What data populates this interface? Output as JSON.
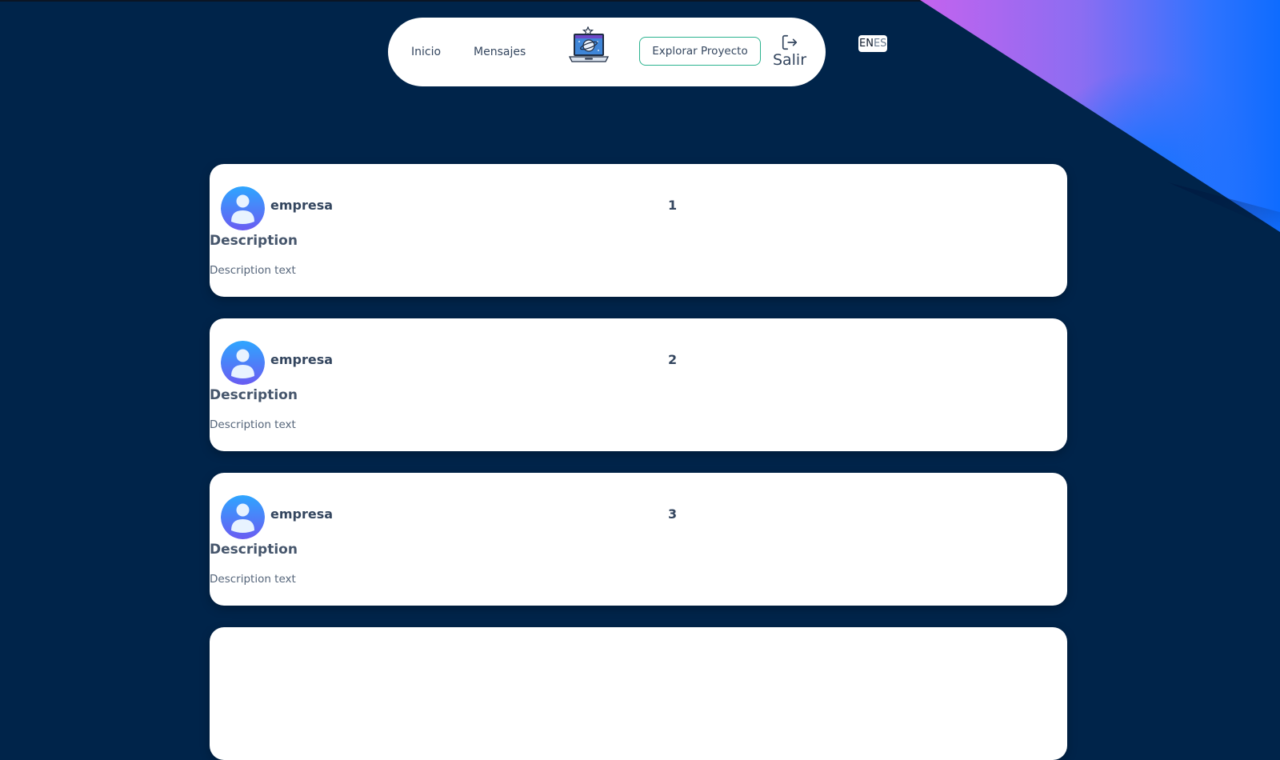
{
  "nav": {
    "inicio": "Inicio",
    "mensajes": "Mensajes",
    "explore_button": "Explorar Proyecto",
    "logout_label": "Salir"
  },
  "lang": {
    "en": "EN",
    "es": "ES"
  },
  "colors": {
    "background": "#00244a",
    "accent_border": "#2bb38f",
    "avatar_gradient_start": "#2ea6ff",
    "avatar_gradient_end": "#6a5cf2"
  },
  "cards": [
    {
      "company": "empresa",
      "number": "1",
      "title": "Description",
      "description": "Description text"
    },
    {
      "company": "empresa",
      "number": "2",
      "title": "Description",
      "description": "Description text"
    },
    {
      "company": "empresa",
      "number": "3",
      "title": "Description",
      "description": "Description text"
    }
  ]
}
